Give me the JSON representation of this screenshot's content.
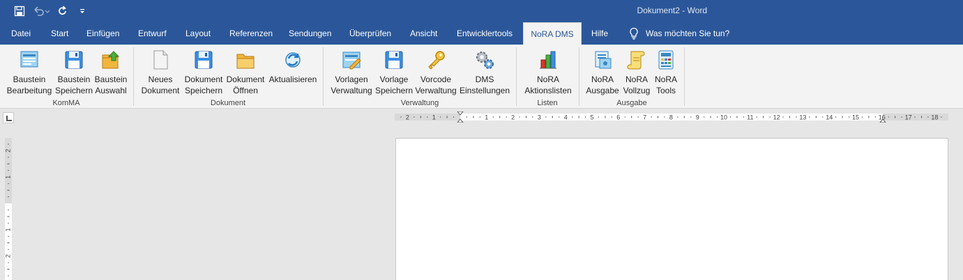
{
  "window": {
    "title": "Dokument2  -  Word"
  },
  "qat": {
    "save_icon": "save-icon",
    "undo_icon": "undo-icon",
    "redo_icon": "redo-icon",
    "customize_icon": "customize-qat-icon"
  },
  "tabs": [
    {
      "label": "Datei"
    },
    {
      "label": "Start"
    },
    {
      "label": "Einfügen"
    },
    {
      "label": "Entwurf"
    },
    {
      "label": "Layout"
    },
    {
      "label": "Referenzen"
    },
    {
      "label": "Sendungen"
    },
    {
      "label": "Überprüfen"
    },
    {
      "label": "Ansicht"
    },
    {
      "label": "Entwicklertools"
    },
    {
      "label": "NoRA DMS"
    },
    {
      "label": "Hilfe"
    }
  ],
  "tellme": {
    "label": "Was möchten Sie tun?",
    "icon": "lightbulb-icon"
  },
  "ribbon": {
    "groups": [
      {
        "label": "KomMA",
        "buttons": [
          {
            "line1": "Baustein",
            "line2": "Bearbeitung",
            "icon": "edit-block-icon"
          },
          {
            "line1": "Baustein",
            "line2": "Speichern",
            "icon": "save-block-icon"
          },
          {
            "line1": "Baustein",
            "line2": "Auswahl",
            "icon": "select-block-icon"
          }
        ]
      },
      {
        "label": "Dokument",
        "buttons": [
          {
            "line1": "Neues",
            "line2": "Dokument",
            "icon": "new-document-icon"
          },
          {
            "line1": "Dokument",
            "line2": "Speichern",
            "icon": "save-document-icon"
          },
          {
            "line1": "Dokument",
            "line2": "Öffnen",
            "icon": "open-folder-icon"
          },
          {
            "line1": "Aktualisieren",
            "line2": "",
            "icon": "refresh-icon"
          }
        ]
      },
      {
        "label": "Verwaltung",
        "buttons": [
          {
            "line1": "Vorlagen",
            "line2": "Verwaltung",
            "icon": "template-manage-icon"
          },
          {
            "line1": "Vorlage",
            "line2": "Speichern",
            "icon": "save-template-icon"
          },
          {
            "line1": "Vorcode",
            "line2": "Verwaltung",
            "icon": "key-icon"
          },
          {
            "line1": "DMS",
            "line2": "Einstellungen",
            "icon": "gears-icon"
          }
        ]
      },
      {
        "label": "Listen",
        "buttons": [
          {
            "line1": "NoRA",
            "line2": "Aktionslisten",
            "icon": "bar-chart-icon"
          }
        ]
      },
      {
        "label": "Ausgabe",
        "buttons": [
          {
            "line1": "NoRA",
            "line2": "Ausgabe",
            "icon": "output-icon"
          },
          {
            "line1": "NoRA",
            "line2": "Vollzug",
            "icon": "scroll-icon"
          },
          {
            "line1": "NoRA",
            "line2": "Tools",
            "icon": "calculator-icon"
          }
        ]
      }
    ]
  },
  "ruler": {
    "h_labels": [
      "2",
      "1",
      "1",
      "2",
      "3",
      "4",
      "5",
      "6",
      "7",
      "8",
      "9",
      "10",
      "11",
      "12",
      "13",
      "14",
      "15",
      "16",
      "17",
      "18"
    ],
    "v_labels": [
      "2",
      "1",
      "1",
      "2"
    ]
  },
  "colors": {
    "titlebar": "#2b579a",
    "ribbon": "#f3f3f3",
    "canvas": "#e6e6e6"
  }
}
